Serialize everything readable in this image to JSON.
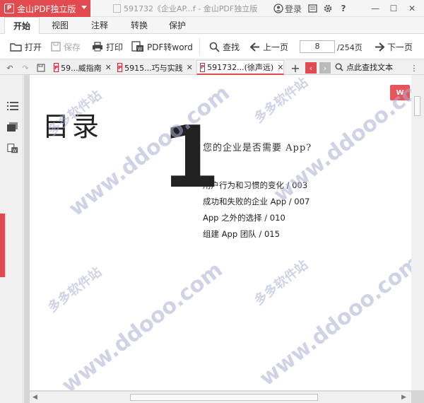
{
  "titlebar": {
    "app_name": "金山PDF独立版",
    "app_logo": "P",
    "doc_title": "591732《企业AP...f - 金山PDF独立版",
    "login": "登录",
    "help": "?",
    "icons": [
      "user-icon",
      "message-icon",
      "gear-icon",
      "help-icon",
      "minimize-icon",
      "maximize-icon",
      "close-icon"
    ]
  },
  "menu_tabs": [
    "开始",
    "视图",
    "注释",
    "转换",
    "保护"
  ],
  "toolbar": {
    "open": "打开",
    "save": "保存",
    "print": "打印",
    "pdf_to_word": "PDF转word",
    "find": "查找",
    "prev": "上一页",
    "page_current": "8",
    "page_total": "/254页",
    "next": "下一页"
  },
  "doc_tabs": [
    {
      "label": "59...威指南"
    },
    {
      "label": "5915...巧与实践"
    },
    {
      "label": "591732...(徐声远)"
    }
  ],
  "search_placeholder": "点此查找文本",
  "page": {
    "toc_heading": "目录",
    "chapter_number": "1",
    "chapter_title": "您的企业是否需要 App?",
    "items": [
      "用户行为和习惯的变化 / 003",
      "成功和失败的企业 App / 007",
      "App 之外的选择 / 010",
      "组建 App 团队 / 015"
    ],
    "word_badge": "W"
  },
  "watermark": {
    "cn": "多多软件站",
    "url": "www.ddooo.com"
  },
  "colors": {
    "accent": "#e14a4f"
  }
}
